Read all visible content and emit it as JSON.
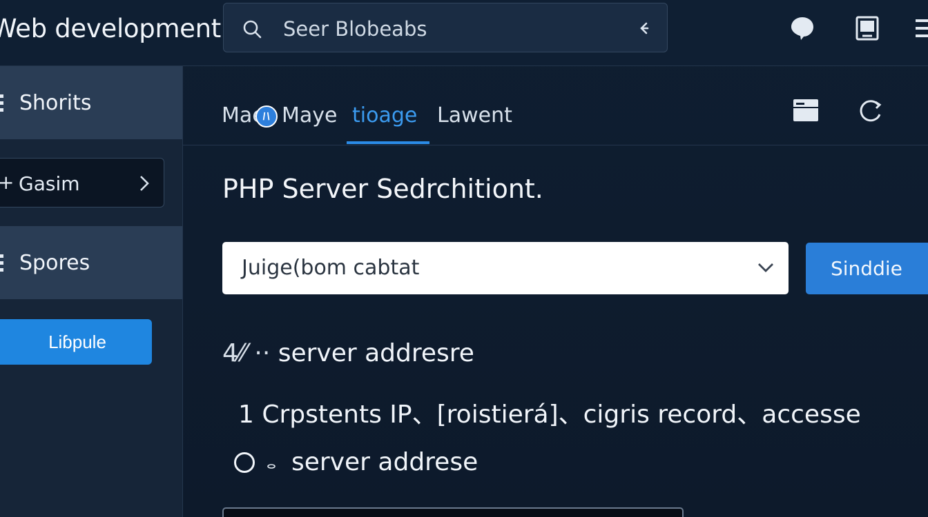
{
  "app": {
    "title": "Web development"
  },
  "search": {
    "value": "Seer Blobeabs",
    "icon": "search-icon"
  },
  "header_icons": [
    "chat-bubble-icon",
    "tablet-icon",
    "menu-icon"
  ],
  "sidebar": {
    "sections": [
      {
        "label": "Shorits",
        "icon": "list-icon"
      },
      {
        "label": "Spores",
        "icon": "list-icon"
      }
    ],
    "item": {
      "label": "Gasim",
      "icon": "plus-icon"
    },
    "button_label": "Liɓpule"
  },
  "tabs": [
    {
      "label": "Mae",
      "active": false
    },
    {
      "label": "Maye",
      "active": false
    },
    {
      "label": "tioage",
      "active": true
    },
    {
      "label": "Lawent",
      "active": false
    }
  ],
  "toolbar_icons": [
    "folder-icon",
    "refresh-icon"
  ],
  "main": {
    "title": "PHP Server Sedrchitiont.",
    "select": {
      "value": "Juige(bom cabtat"
    },
    "primary_button": "Sinddie",
    "lines": {
      "line1_prefix": "4⁄⁄ ··",
      "line1_text": "server addresre",
      "line2": "1 Crpstents IP、[roistierá]、cigris record、accesse",
      "line3": "server addrese"
    }
  },
  "colors": {
    "accent": "#2b8be6",
    "background": "#0e1b2d",
    "sidebar": "#162538",
    "sidebar_section": "#2a3d55"
  }
}
